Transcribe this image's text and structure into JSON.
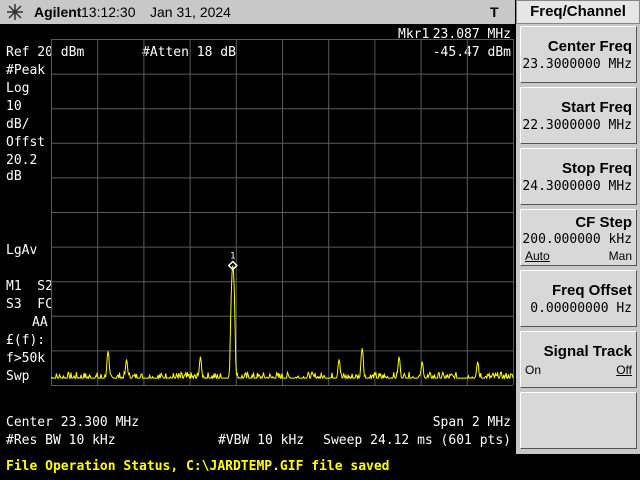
{
  "header": {
    "brand": "Agilent",
    "time": "13:12:30",
    "date": "Jan 31, 2024",
    "trigger": "T"
  },
  "marker": {
    "label": "Mkr1",
    "freq": "23.087 MHz",
    "level": "-45.47 dBm",
    "number": "1"
  },
  "ref": "Ref 20 dBm",
  "atten": "#Atten 18 dB",
  "left_annot": [
    "#Peak",
    "Log",
    "10",
    "dB/",
    "Offst",
    "20.2",
    "dB"
  ],
  "lgav": "LgAv",
  "m1s2": "M1  S2",
  "s3fc": "S3  FC",
  "aa": "AA",
  "ff": "£(f):",
  "f50k": "f>50k",
  "swp": "Swp",
  "footer": {
    "center": "Center 23.300 MHz",
    "span": "Span 2 MHz",
    "rbw": "#Res BW 10 kHz",
    "vbw": "#VBW 10 kHz",
    "sweep": "Sweep 24.12 ms (601 pts)"
  },
  "menu": {
    "title": "Freq/Channel",
    "keys": [
      {
        "label": "Center Freq",
        "value": "23.3000000 MHz"
      },
      {
        "label": "Start Freq",
        "value": "22.3000000 MHz"
      },
      {
        "label": "Stop Freq",
        "value": "24.3000000 MHz"
      },
      {
        "label": "CF Step",
        "value": "200.000000 kHz",
        "left": "Auto",
        "right": "Man"
      },
      {
        "label": "Freq Offset",
        "value": "0.00000000 Hz"
      },
      {
        "label": "Signal Track",
        "left": "On",
        "right": "Off"
      },
      {
        "label": ""
      }
    ]
  },
  "status": "File Operation Status, C:\\JARDTEMP.GIF file saved",
  "colors": {
    "trace": "#ffff00",
    "grid": "#5a5a5a",
    "status_text": "#ffff00",
    "marker": "#ffffff"
  },
  "trace": {
    "start_mhz": 22.3,
    "stop_mhz": 24.3,
    "ref_dbm": 20,
    "db_per_div": 10,
    "points": 601,
    "noise_floor_dbm": -78,
    "peaks": [
      {
        "freq_mhz": 22.547,
        "level_dbm": -71
      },
      {
        "freq_mhz": 22.627,
        "level_dbm": -74
      },
      {
        "freq_mhz": 22.947,
        "level_dbm": -73
      },
      {
        "freq_mhz": 23.087,
        "level_dbm": -45.47
      },
      {
        "freq_mhz": 23.547,
        "level_dbm": -74
      },
      {
        "freq_mhz": 23.647,
        "level_dbm": -70
      },
      {
        "freq_mhz": 23.807,
        "level_dbm": -73
      },
      {
        "freq_mhz": 23.907,
        "level_dbm": -75
      },
      {
        "freq_mhz": 24.147,
        "level_dbm": -75
      }
    ]
  }
}
